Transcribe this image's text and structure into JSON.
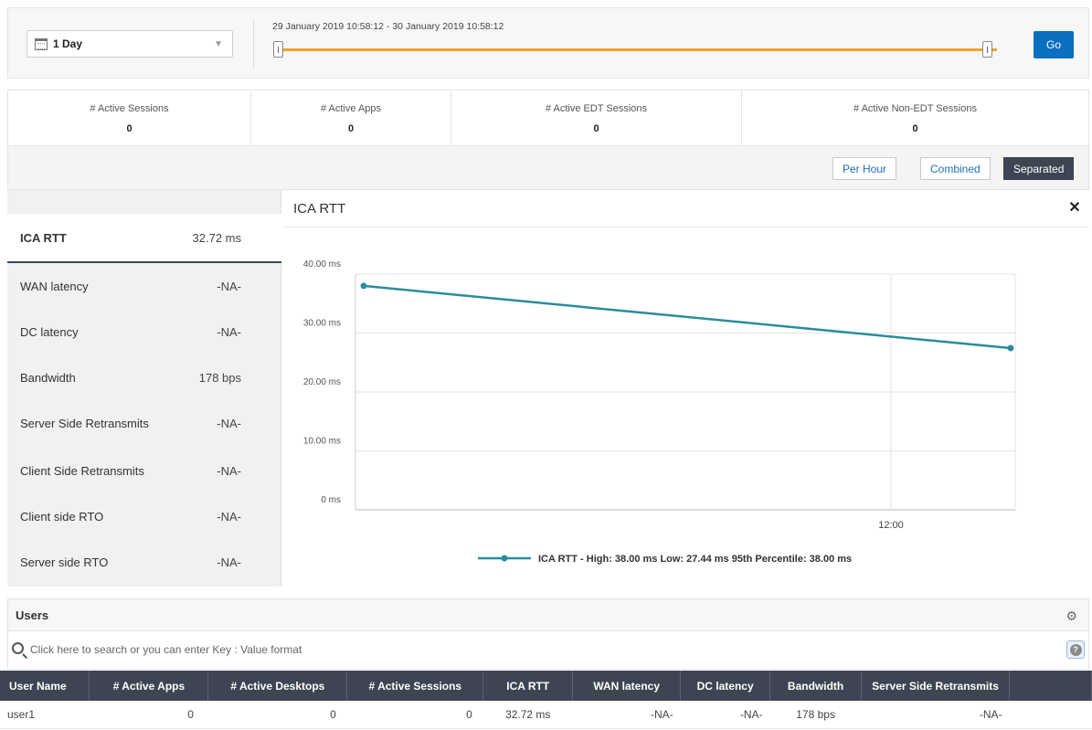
{
  "filter": {
    "duration": "1 Day",
    "range_label": "29 January 2019 10:58:12 - 30 January 2019 10:58:12",
    "go_label": "Go",
    "slider_color": "#f0a429"
  },
  "stats": [
    {
      "label": "# Active Sessions",
      "value": "0"
    },
    {
      "label": "# Active Apps",
      "value": "0"
    },
    {
      "label": "# Active EDT Sessions",
      "value": "0"
    },
    {
      "label": "# Active Non-EDT Sessions",
      "value": "0"
    }
  ],
  "toolbar": {
    "per_hour": "Per Hour",
    "combined": "Combined",
    "separated": "Separated",
    "active": "Separated"
  },
  "metrics": [
    {
      "label": "ICA RTT",
      "value": "32.72 ms"
    },
    {
      "label": "WAN latency",
      "value": "-NA-"
    },
    {
      "label": "DC latency",
      "value": "-NA-"
    },
    {
      "label": "Bandwidth",
      "value": "178 bps"
    },
    {
      "label": "Server Side Retransmits",
      "value": "-NA-"
    },
    {
      "label": "Client Side Retransmits",
      "value": "-NA-"
    },
    {
      "label": "Client side RTO",
      "value": "-NA-"
    },
    {
      "label": "Server side RTO",
      "value": "-NA-"
    }
  ],
  "chart": {
    "title": "ICA RTT",
    "close_icon": "close-icon"
  },
  "chart_data": {
    "type": "line",
    "title": "ICA RTT",
    "xlabel": "",
    "ylabel": "",
    "yticks": [
      "0 ms",
      "10.00 ms",
      "20.00 ms",
      "30.00 ms",
      "40.00 ms"
    ],
    "ylim": [
      0,
      40
    ],
    "xticks": [
      "12:00"
    ],
    "series": [
      {
        "name": "ICA RTT - High: 38.00 ms Low: 27.44 ms 95th Percentile: 38.00 ms",
        "x": [
          "29 January 2019 11:00",
          "30 January 2019 10:00"
        ],
        "values": [
          38.0,
          27.44
        ],
        "color": "#2a8c9c"
      }
    ],
    "grid": true,
    "legend": "bottom"
  },
  "users": {
    "title": "Users",
    "search_placeholder": "Click here to search or you can enter Key : Value format",
    "columns": [
      "User Name",
      "# Active Apps",
      "# Active Desktops",
      "# Active Sessions",
      "ICA RTT",
      "WAN latency",
      "DC latency",
      "Bandwidth",
      "Server Side Retransmits"
    ],
    "rows": [
      [
        "user1",
        "0",
        "0",
        "0",
        "32.72 ms",
        "-NA-",
        "-NA-",
        "178 bps",
        "-NA-"
      ]
    ]
  },
  "colors": {
    "accent": "#0b6fc2",
    "header_dark": "#3d4552",
    "link": "#1f6fb5"
  }
}
